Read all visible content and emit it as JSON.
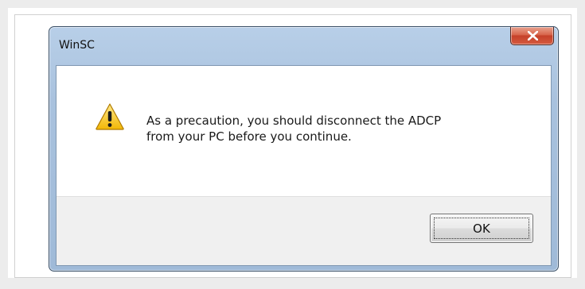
{
  "window": {
    "title": "WinSC"
  },
  "dialog": {
    "message_line1": "As a precaution, you should disconnect the ADCP",
    "message_line2": "from your PC before you continue.",
    "icon": "warning-icon",
    "ok_label": "OK"
  },
  "colors": {
    "titlebar": "#a9c2de",
    "close_button": "#c5412a",
    "button_bar": "#f0f0f0"
  }
}
